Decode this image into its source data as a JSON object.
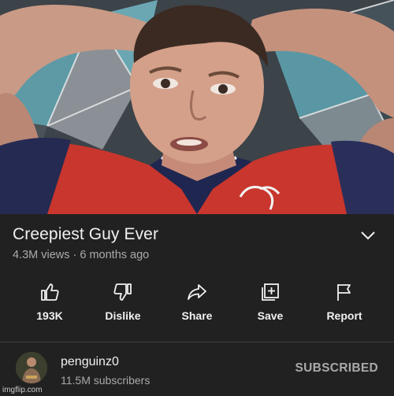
{
  "video": {
    "title": "Creepiest Guy Ever",
    "views": "4.3M views",
    "separator": "·",
    "age": "6 months ago"
  },
  "actions": [
    {
      "label": "193K",
      "icon": "thumbs-up-icon"
    },
    {
      "label": "Dislike",
      "icon": "thumbs-down-icon"
    },
    {
      "label": "Share",
      "icon": "share-arrow-icon"
    },
    {
      "label": "Save",
      "icon": "save-playlist-icon"
    },
    {
      "label": "Report",
      "icon": "flag-icon"
    }
  ],
  "channel": {
    "name": "penguinz0",
    "subscribers": "11.5M subscribers",
    "subscribe_state": "SUBSCRIBED"
  },
  "watermark": "imgflip.com",
  "colors": {
    "background": "#212121",
    "primary_text": "#f1f1f1",
    "secondary_text": "#aaaaaa"
  }
}
